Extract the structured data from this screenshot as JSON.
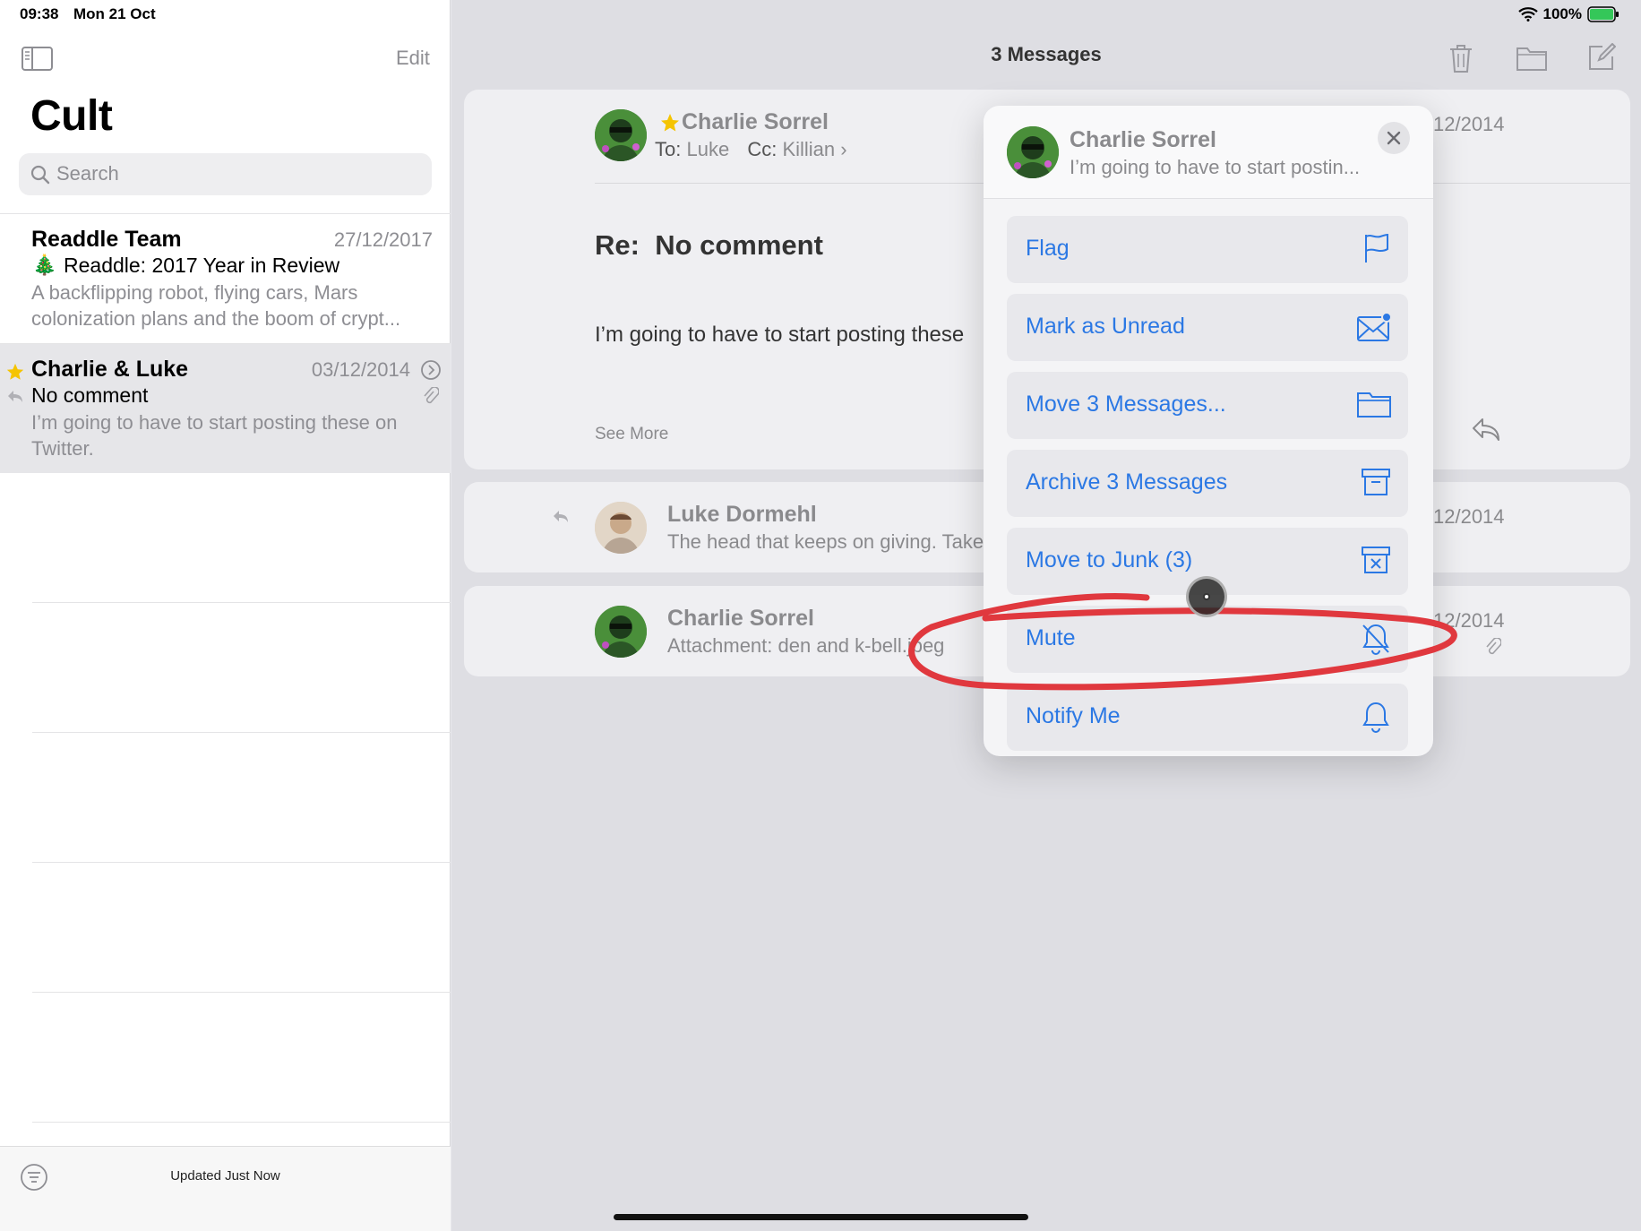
{
  "status": {
    "time": "09:38",
    "date": "Mon 21 Oct",
    "battery": "100%"
  },
  "sidebar": {
    "edit_label": "Edit",
    "title": "Cult",
    "search_placeholder": "Search",
    "mails": [
      {
        "sender": "Readdle Team",
        "date": "27/12/2017",
        "subject": "Readdle: 2017 Year in Review",
        "preview1": "A backflipping robot, flying cars, Mars",
        "preview2": "colonization plans and the boom of crypt..."
      },
      {
        "sender": "Charlie & Luke",
        "date": "03/12/2014",
        "subject": "No comment",
        "preview1": "I’m going to have to start posting these on",
        "preview2": "Twitter."
      }
    ],
    "footer_status": "Updated Just Now"
  },
  "main": {
    "title": "3 Messages",
    "thread": [
      {
        "name": "Charlie Sorrel",
        "to_label": "To:",
        "to": "Luke",
        "cc_label": "Cc:",
        "cc": "Killian",
        "date": "12/2014",
        "subject_prefix": "Re:",
        "subject": "No comment",
        "body": "I’m going to have to start posting these",
        "see_more": "See More"
      },
      {
        "name": "Luke Dormehl",
        "preview": "The head that keeps on giving. Take",
        "date": "12/2014"
      },
      {
        "name": "Charlie Sorrel",
        "preview": "Attachment: den and k-bell.jpeg",
        "date": "12/2014"
      }
    ]
  },
  "menu": {
    "name": "Charlie Sorrel",
    "preview": "I’m going to have to start postin...",
    "items": [
      {
        "label": "Flag",
        "icon": "flag-icon"
      },
      {
        "label": "Mark as Unread",
        "icon": "envelope-unread-icon"
      },
      {
        "label": "Move 3 Messages...",
        "icon": "folder-icon"
      },
      {
        "label": "Archive 3 Messages",
        "icon": "archive-box-icon"
      },
      {
        "label": "Move to Junk (3)",
        "icon": "junk-box-icon"
      },
      {
        "label": "Mute",
        "icon": "bell-slash-icon"
      },
      {
        "label": "Notify Me",
        "icon": "bell-icon"
      }
    ]
  },
  "colors": {
    "accent": "#2b78e4",
    "annotation": "#e0383e",
    "star": "#f5c400",
    "battery": "#34c759"
  }
}
